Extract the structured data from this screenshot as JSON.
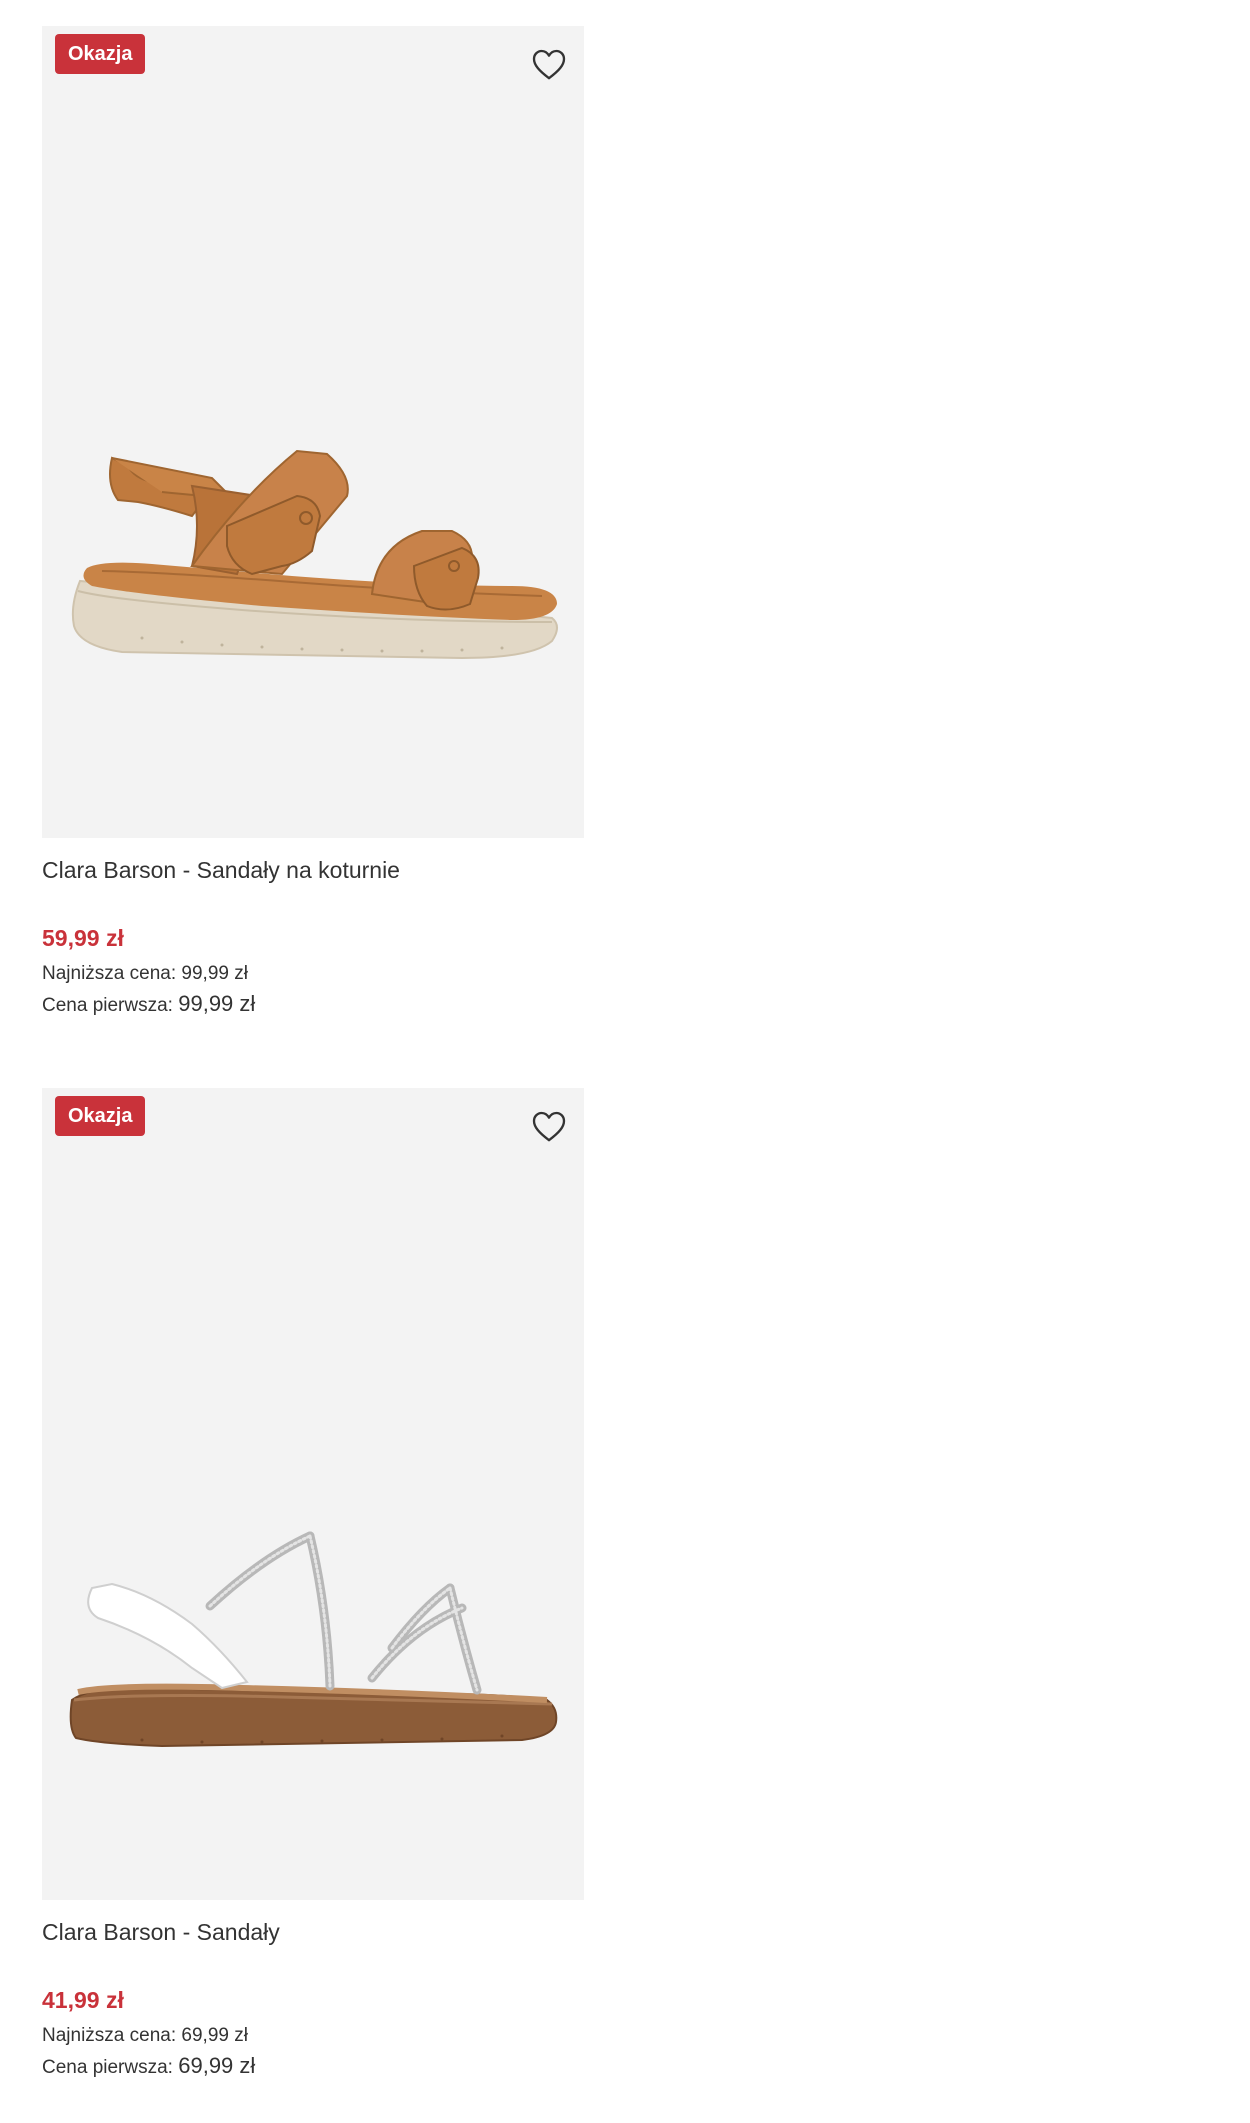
{
  "products": [
    {
      "badge": "Okazja",
      "title": "Clara Barson - Sandały na koturnie",
      "price": "59,99 zł",
      "lowest_label": "Najniższa cena: ",
      "lowest_value": "99,99 zł",
      "original_label": "Cena pierwsza: ",
      "original_value": "99,99 zł",
      "image_icon": "tan-wedge-sandal",
      "favorite_icon": "heart-outline-icon"
    },
    {
      "badge": "Okazja",
      "title": "Clara Barson - Sandały",
      "price": "41,99 zł",
      "lowest_label": "Najniższa cena: ",
      "lowest_value": "69,99 zł",
      "original_label": "Cena pierwsza: ",
      "original_value": "69,99 zł",
      "image_icon": "silver-strap-sandal",
      "favorite_icon": "heart-outline-icon"
    }
  ],
  "colors": {
    "badge_bg": "#c9323a",
    "price": "#c9323a",
    "card_bg": "#f3f3f3",
    "text": "#333333"
  }
}
